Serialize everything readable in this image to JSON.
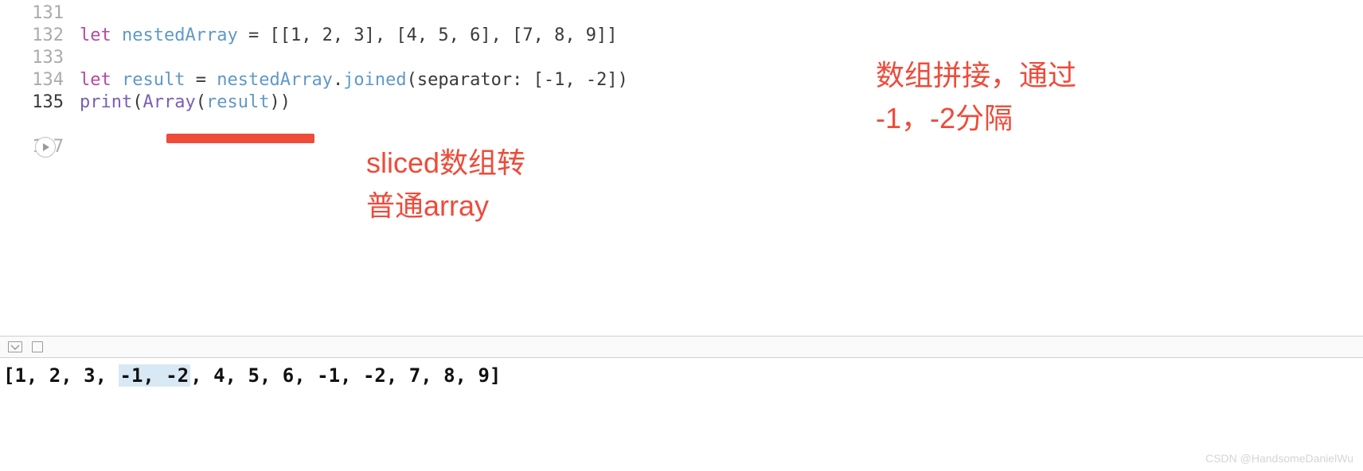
{
  "gutter": {
    "l131": "131",
    "l132": "132",
    "l133": "133",
    "l134": "134",
    "l135": "135",
    "l136": "",
    "l137": "137"
  },
  "code": {
    "l132": {
      "kw": "let",
      "sp1": " ",
      "id": "nestedArray",
      "eq": " = ",
      "arr": "[[1, 2, 3], [4, 5, 6], [7, 8, 9]]"
    },
    "l134": {
      "kw": "let",
      "sp1": " ",
      "id": "result",
      "eq": " = ",
      "obj": "nestedArray",
      "dot": ".",
      "method": "joined",
      "open": "(",
      "param": "separator: [-1, -2]",
      "close": ")"
    },
    "l135": {
      "fn": "print",
      "open": "(",
      "type": "Array",
      "open2": "(",
      "arg": "result",
      "close2": ")",
      "close": ")"
    }
  },
  "annotations": {
    "a1": {
      "line1": "sliced数组转",
      "line2": "普通array"
    },
    "a2": {
      "line1": "数组拼接，通过",
      "line2": "-1，-2分隔"
    }
  },
  "console": {
    "pre": "[1, 2, 3, ",
    "hl": "-1, -2",
    "cursor": ",",
    "post": " 4, 5, 6, -1, -2, 7, 8, 9]"
  },
  "watermark": "CSDN @HandsomeDanielWu"
}
